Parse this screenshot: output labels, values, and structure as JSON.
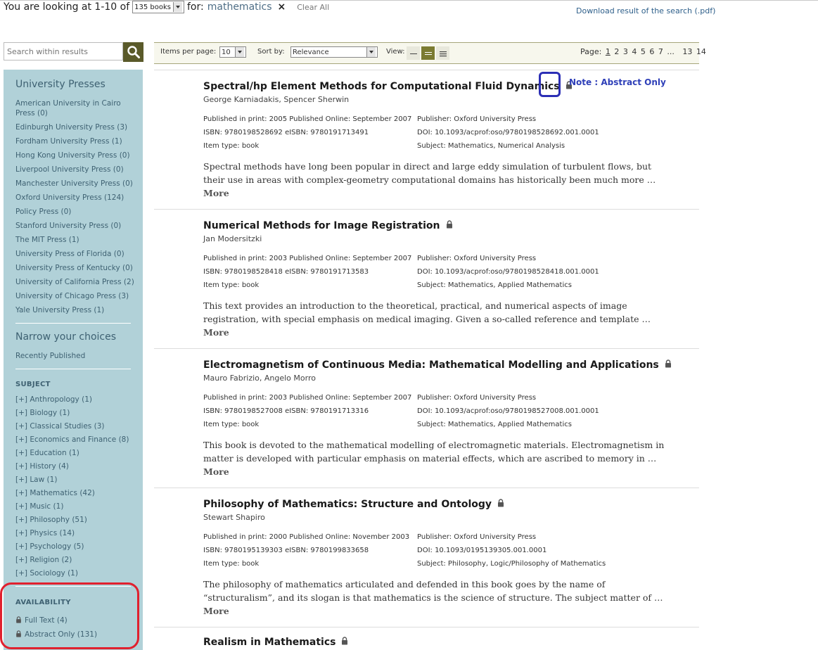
{
  "header": {
    "looking_prefix": "You are looking at 1-10 of",
    "count_select": "135 books",
    "for_label": "for:",
    "query": "mathematics",
    "clear_x": "×",
    "clear_all": "Clear All",
    "download": "Download result of the search (.pdf)"
  },
  "search": {
    "placeholder": "Search within results"
  },
  "sidebar": {
    "presses_heading": "University Presses",
    "presses": [
      "American University in Cairo Press (0)",
      "Edinburgh University Press (3)",
      "Fordham University Press (1)",
      "Hong Kong University Press (0)",
      "Liverpool University Press (0)",
      "Manchester University Press (0)",
      "Oxford University Press (124)",
      "Policy Press (0)",
      "Stanford University Press (0)",
      "The MIT Press (1)",
      "University Press of Florida (0)",
      "University Press of Kentucky (0)",
      "University of California Press (2)",
      "University of Chicago Press (3)",
      "Yale University Press (1)"
    ],
    "narrow_heading": "Narrow your choices",
    "recently_published": "Recently Published",
    "subject_heading": "SUBJECT",
    "subjects": [
      "[+] Anthropology (1)",
      "[+] Biology (1)",
      "[+] Classical Studies (3)",
      "[+] Economics and Finance (8)",
      "[+] Education (1)",
      "[+] History (4)",
      "[+] Law (1)",
      "[+] Mathematics (42)",
      "[+] Music (1)",
      "[+] Philosophy (51)",
      "[+] Physics (14)",
      "[+] Psychology (5)",
      "[+] Religion (2)",
      "[+] Sociology (1)"
    ],
    "availability_heading": "AVAILABILITY",
    "availability": [
      "Full Text (4)",
      "Abstract Only (131)"
    ]
  },
  "toolbar": {
    "items_per_page_label": "Items per page:",
    "items_per_page": "10",
    "sort_by_label": "Sort by:",
    "sort_by": "Relevance",
    "view_label": "View:",
    "page_label": "Page:",
    "pages": [
      "1",
      "2",
      "3",
      "4",
      "5",
      "6",
      "7",
      "...",
      "13",
      "14"
    ]
  },
  "note": "Note : Abstract Only",
  "results": [
    {
      "title": "Spectral/hp Element Methods for Computational Fluid Dynamics",
      "authors": "George Karniadakis, Spencer Sherwin",
      "published": "Published in print:  2005 Published Online: September 2007",
      "isbn": "ISBN:  9780198528692  eISBN:  9780191713491",
      "item_type": "Item type:  book",
      "publisher": "Publisher:  Oxford University Press",
      "doi": "DOI:  10.1093/acprof:oso/9780198528692.001.0001",
      "subject": "Subject:  Mathematics, Numerical Analysis",
      "abstract": "Spectral methods have long been popular in direct and large eddy simulation of turbulent flows, but their use in areas with complex-geometry computational domains has historically been much more …",
      "more": "More"
    },
    {
      "title": "Numerical Methods for Image Registration",
      "authors": "Jan Modersitzki",
      "published": "Published in print:  2003 Published Online: September 2007",
      "isbn": "ISBN:  9780198528418  eISBN:  9780191713583",
      "item_type": "Item type:  book",
      "publisher": "Publisher:  Oxford University Press",
      "doi": "DOI:  10.1093/acprof:oso/9780198528418.001.0001",
      "subject": "Subject:  Mathematics, Applied Mathematics",
      "abstract": "This text provides an introduction to the theoretical, practical, and numerical aspects of image registration, with special emphasis on medical imaging. Given a so-called reference and template …",
      "more": "More"
    },
    {
      "title": "Electromagnetism of Continuous Media: Mathematical Modelling and Applications",
      "authors": "Mauro Fabrizio, Angelo Morro",
      "published": "Published in print:  2003 Published Online: September 2007",
      "isbn": "ISBN:  9780198527008  eISBN:  9780191713316",
      "item_type": "Item type:  book",
      "publisher": "Publisher:  Oxford University Press",
      "doi": "DOI:  10.1093/acprof:oso/9780198527008.001.0001",
      "subject": "Subject:  Mathematics, Applied Mathematics",
      "abstract": "This book is devoted to the mathematical modelling of electromagnetic materials. Electromagnetism in matter is developed with particular emphasis on material effects, which are ascribed to memory in …",
      "more": "More"
    },
    {
      "title": "Philosophy of Mathematics: Structure and Ontology",
      "authors": "Stewart Shapiro",
      "published": "Published in print:  2000 Published Online: November 2003",
      "isbn": "ISBN:  9780195139303  eISBN:  9780199833658",
      "item_type": "Item type:  book",
      "publisher": "Publisher:  Oxford University Press",
      "doi": "DOI:  10.1093/0195139305.001.0001",
      "subject": "Subject:  Philosophy, Logic/Philosophy of Mathematics",
      "abstract": "The philosophy of mathematics articulated and defended in this book goes by the name of “structuralism”, and its slogan is that mathematics is the science of structure. The subject matter of …",
      "more": "More"
    },
    {
      "title": "Realism in Mathematics"
    }
  ],
  "colors": {
    "sidebar_bg": "#b1d1d8",
    "sidebar_text": "#3e6172",
    "search_button": "#5a5a2a",
    "availability_highlight": "#e0202e",
    "note_callout": "#2c2fb5"
  }
}
